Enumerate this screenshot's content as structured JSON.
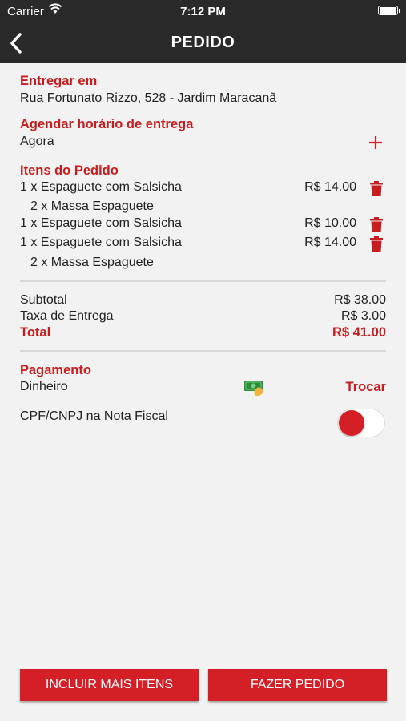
{
  "status_bar": {
    "carrier": "Carrier",
    "time": "7:12 PM"
  },
  "nav": {
    "title": "PEDIDO"
  },
  "delivery": {
    "label": "Entregar em",
    "address": "Rua Fortunato Rizzo, 528 - Jardim Maracanã"
  },
  "schedule": {
    "label": "Agendar horário de entrega",
    "value": "Agora"
  },
  "items": {
    "label": "Itens do Pedido",
    "list": [
      {
        "name": "1 x Espaguete com Salsicha",
        "price": "R$ 14.00",
        "sub": "2 x Massa Espaguete"
      },
      {
        "name": "1 x Espaguete com Salsicha",
        "price": "R$ 10.00",
        "sub": ""
      },
      {
        "name": "1 x Espaguete com Salsicha",
        "price": "R$ 14.00",
        "sub": "2 x Massa Espaguete"
      }
    ]
  },
  "totals": {
    "subtotal_label": "Subtotal",
    "subtotal": "R$ 38.00",
    "fee_label": "Taxa de Entrega",
    "fee": "R$ 3.00",
    "total_label": "Total",
    "total": "R$ 41.00"
  },
  "payment": {
    "label": "Pagamento",
    "method": "Dinheiro",
    "change_label": "Trocar"
  },
  "cpf": {
    "label": "CPF/CNPJ na Nota Fiscal",
    "enabled": false
  },
  "buttons": {
    "add_items": "INCLUIR MAIS ITENS",
    "place_order": "FAZER PEDIDO"
  },
  "colors": {
    "accent": "#d41f26",
    "label_red": "#c81d1f",
    "bar": "#2a2a2a",
    "background": "#f2f2f2"
  }
}
